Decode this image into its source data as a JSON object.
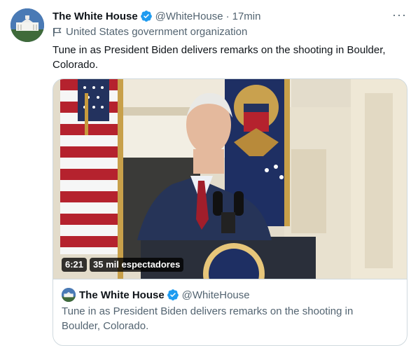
{
  "tweet": {
    "author_name": "The White House",
    "handle": "@WhiteHouse",
    "separator": "·",
    "time": "17min",
    "more_label": "···",
    "account_label": "United States government organization",
    "text": "Tune in as President Biden delivers remarks on the shooting in Boulder, Colorado."
  },
  "media": {
    "duration": "6:21",
    "views": "35 mil espectadores"
  },
  "quoted": {
    "author_name": "The White House",
    "handle": "@WhiteHouse",
    "text": "Tune in as President Biden delivers remarks on the shooting in Boulder, Colorado."
  },
  "icons": {
    "verified": "verified-badge-icon",
    "label_flag": "flag-icon",
    "more": "more-options-icon"
  },
  "colors": {
    "accent": "#1d9bf0",
    "secondary_text": "#536471",
    "primary_text": "#0f1419",
    "border": "#cfd9de"
  }
}
